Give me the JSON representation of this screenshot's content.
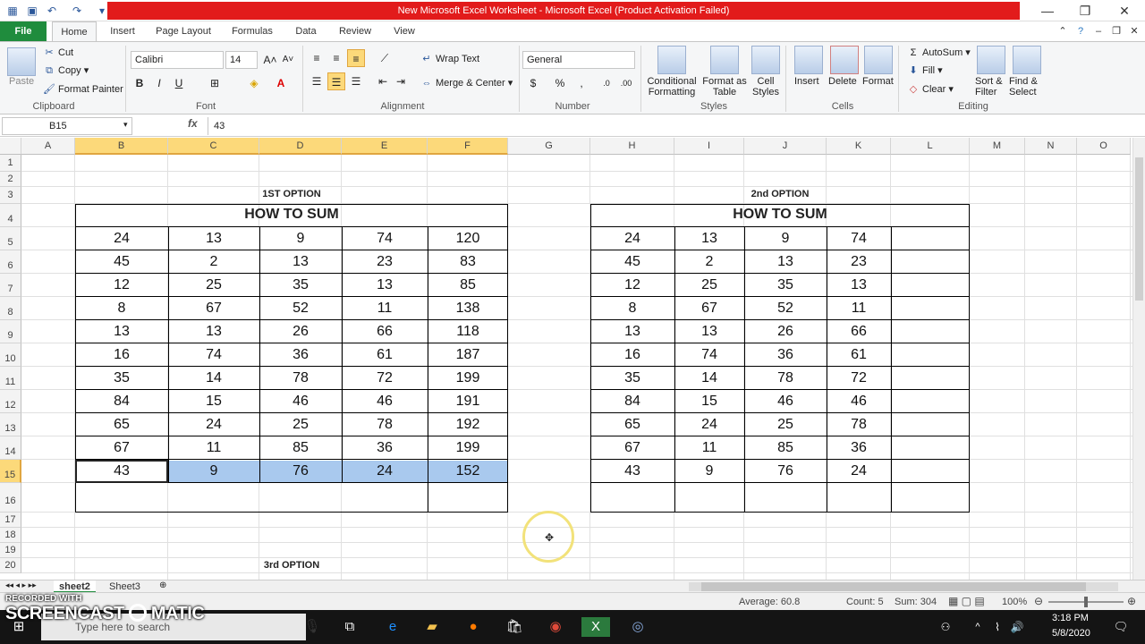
{
  "title_bar": {
    "title": "New Microsoft Excel Worksheet - Microsoft Excel (Product Activation Failed)",
    "accent": "#e21b1b"
  },
  "ribbon_tabs": [
    "File",
    "Home",
    "Insert",
    "Page Layout",
    "Formulas",
    "Data",
    "Review",
    "View"
  ],
  "active_tab": "Home",
  "ribbon": {
    "clipboard": {
      "paste": "Paste",
      "cut": "Cut",
      "copy": "Copy",
      "format_painter": "Format Painter",
      "label": "Clipboard"
    },
    "font": {
      "name": "Calibri",
      "size": "14",
      "label": "Font"
    },
    "alignment": {
      "wrap_text": "Wrap Text",
      "merge_center": "Merge & Center",
      "label": "Alignment"
    },
    "number": {
      "format": "General",
      "label": "Number"
    },
    "styles": {
      "conditional": "Conditional Formatting",
      "format_table": "Format as Table",
      "cell_styles": "Cell Styles",
      "label": "Styles"
    },
    "cells": {
      "insert": "Insert",
      "delete": "Delete",
      "format": "Format",
      "label": "Cells"
    },
    "editing": {
      "autosum": "AutoSum",
      "fill": "Fill",
      "clear": "Clear",
      "sort_filter": "Sort & Filter",
      "find_select": "Find & Select",
      "label": "Editing"
    }
  },
  "formula_bar": {
    "name_box": "B15",
    "fx": "fx",
    "formula": "43"
  },
  "columns": [
    "A",
    "B",
    "C",
    "D",
    "E",
    "F",
    "G",
    "H",
    "I",
    "J",
    "K",
    "L",
    "M",
    "N",
    "O"
  ],
  "rows": [
    "1",
    "2",
    "3",
    "4",
    "5",
    "6",
    "7",
    "8",
    "9",
    "10",
    "11",
    "12",
    "13",
    "14",
    "15",
    "16",
    "17",
    "18",
    "19",
    "20"
  ],
  "table1": {
    "caption": "1ST OPTION",
    "title": "HOW TO SUM",
    "rows": [
      [
        "24",
        "13",
        "9",
        "74",
        "120"
      ],
      [
        "45",
        "2",
        "13",
        "23",
        "83"
      ],
      [
        "12",
        "25",
        "35",
        "13",
        "85"
      ],
      [
        "8",
        "67",
        "52",
        "11",
        "138"
      ],
      [
        "13",
        "13",
        "26",
        "66",
        "118"
      ],
      [
        "16",
        "74",
        "36",
        "61",
        "187"
      ],
      [
        "35",
        "14",
        "78",
        "72",
        "199"
      ],
      [
        "84",
        "15",
        "46",
        "46",
        "191"
      ],
      [
        "65",
        "24",
        "25",
        "78",
        "192"
      ],
      [
        "67",
        "11",
        "85",
        "36",
        "199"
      ],
      [
        "43",
        "9",
        "76",
        "24",
        "152"
      ]
    ]
  },
  "table2": {
    "caption": "2nd OPTION",
    "title": "HOW TO SUM",
    "rows": [
      [
        "24",
        "13",
        "9",
        "74"
      ],
      [
        "45",
        "2",
        "13",
        "23"
      ],
      [
        "12",
        "25",
        "35",
        "13"
      ],
      [
        "8",
        "67",
        "52",
        "11"
      ],
      [
        "13",
        "13",
        "26",
        "66"
      ],
      [
        "16",
        "74",
        "36",
        "61"
      ],
      [
        "35",
        "14",
        "78",
        "72"
      ],
      [
        "84",
        "15",
        "46",
        "46"
      ],
      [
        "65",
        "24",
        "25",
        "78"
      ],
      [
        "67",
        "11",
        "85",
        "36"
      ],
      [
        "43",
        "9",
        "76",
        "24"
      ]
    ]
  },
  "caption3": "3rd OPTION",
  "sheet_tabs": [
    "sheet2",
    "Sheet3"
  ],
  "active_sheet": "sheet2",
  "status": {
    "average": "Average: 60.8",
    "count": "Count: 5",
    "sum": "Sum: 304",
    "zoom": "100%"
  },
  "taskbar": {
    "search_placeholder": "Type here to search",
    "time": "3:18 PM",
    "date": "5/8/2020"
  },
  "watermark": {
    "line1": "RECORDED WITH",
    "line2": "SCREENCAST",
    "line3": "MATIC"
  },
  "colors": {
    "file_tab": "#1f8c3d",
    "selection": "#a9c9ee",
    "header_selected": "#fcd97a"
  }
}
